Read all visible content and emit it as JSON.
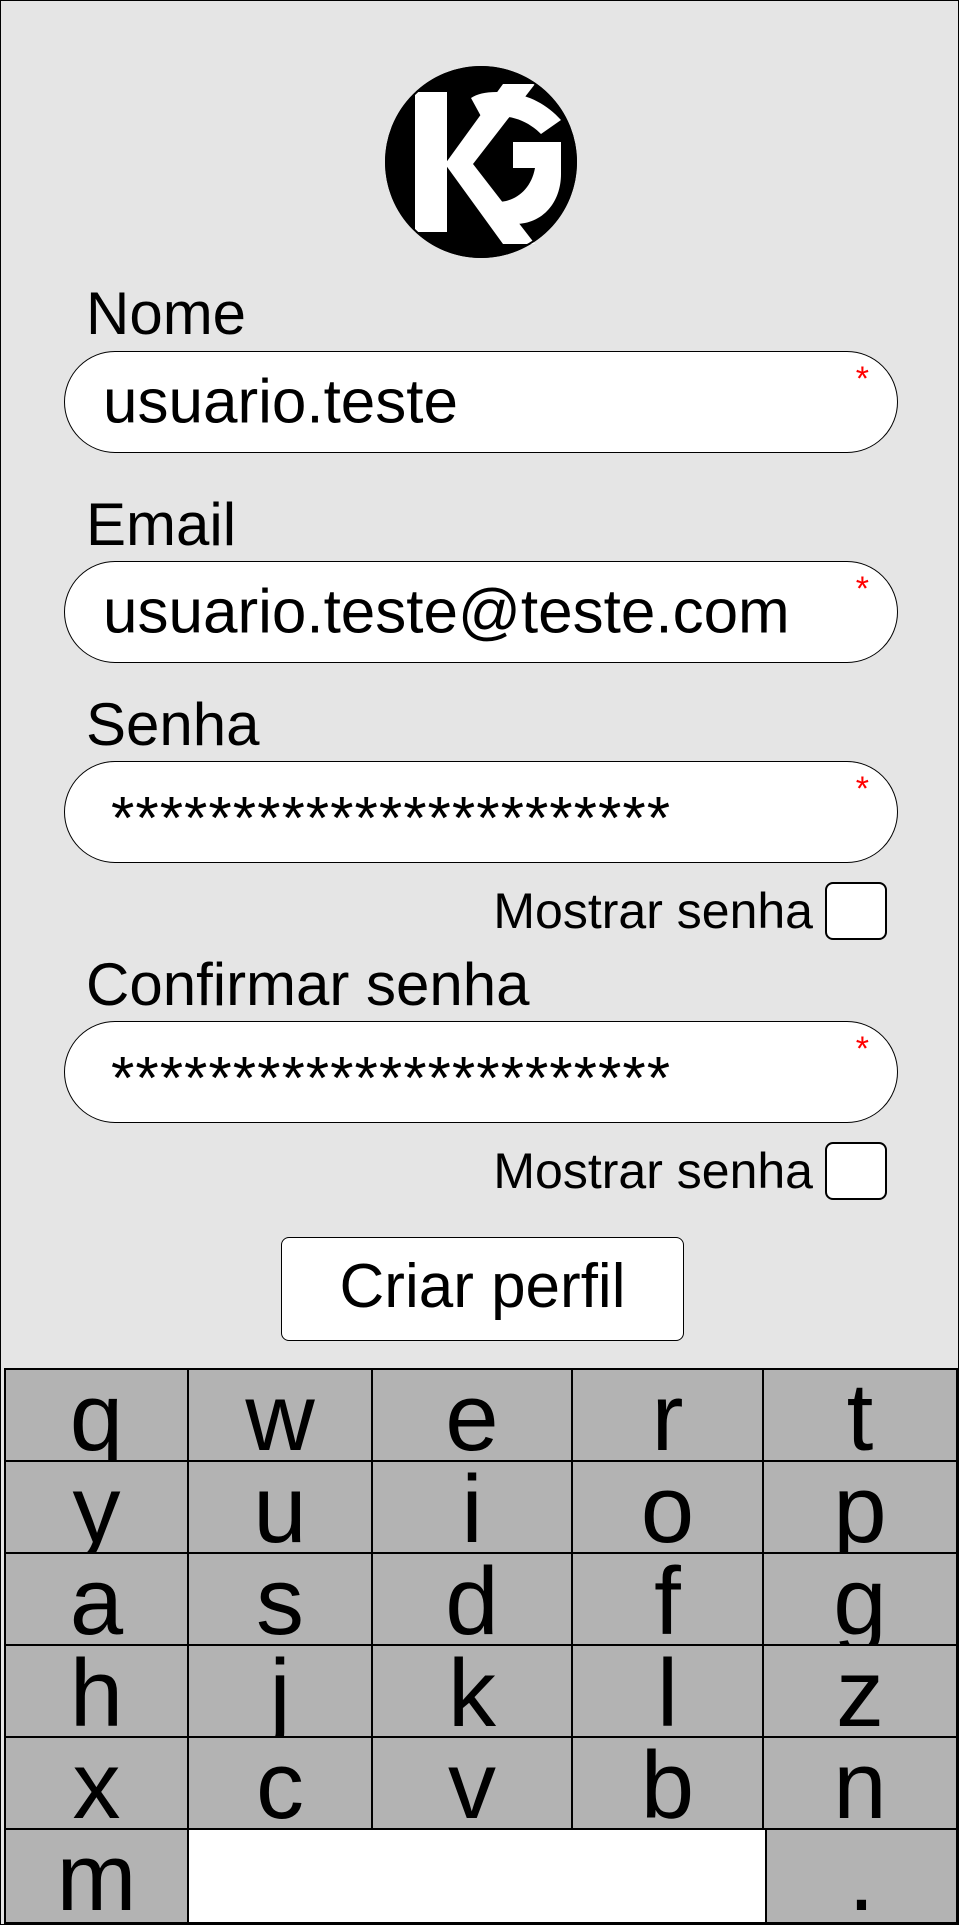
{
  "logo": {
    "text": "KG",
    "icon": "kg-logo-icon"
  },
  "form": {
    "name": {
      "label": "Nome",
      "value": "usuario.teste",
      "required_mark": "*"
    },
    "email": {
      "label": "Email",
      "value": "usuario.teste@teste.com",
      "required_mark": "*"
    },
    "password": {
      "label": "Senha",
      "value": "***********************",
      "required_mark": "*",
      "show_label": "Mostrar senha",
      "show_checked": false
    },
    "confirm_password": {
      "label": "Confirmar senha",
      "value": "***********************",
      "required_mark": "*",
      "show_label": "Mostrar senha",
      "show_checked": false
    },
    "submit_label": "Criar perfil"
  },
  "keyboard": {
    "rows": [
      [
        "q",
        "w",
        "e",
        "r",
        "t"
      ],
      [
        "y",
        "u",
        "i",
        "o",
        "p"
      ],
      [
        "a",
        "s",
        "d",
        "f",
        "g"
      ],
      [
        "h",
        "j",
        "k",
        "l",
        "z"
      ],
      [
        "x",
        "c",
        "v",
        "b",
        "n"
      ]
    ],
    "bottom": {
      "left": "m",
      "right": "."
    }
  },
  "colors": {
    "background": "#e5e5e5",
    "key": "#b3b3b3",
    "required": "#ff0000"
  }
}
